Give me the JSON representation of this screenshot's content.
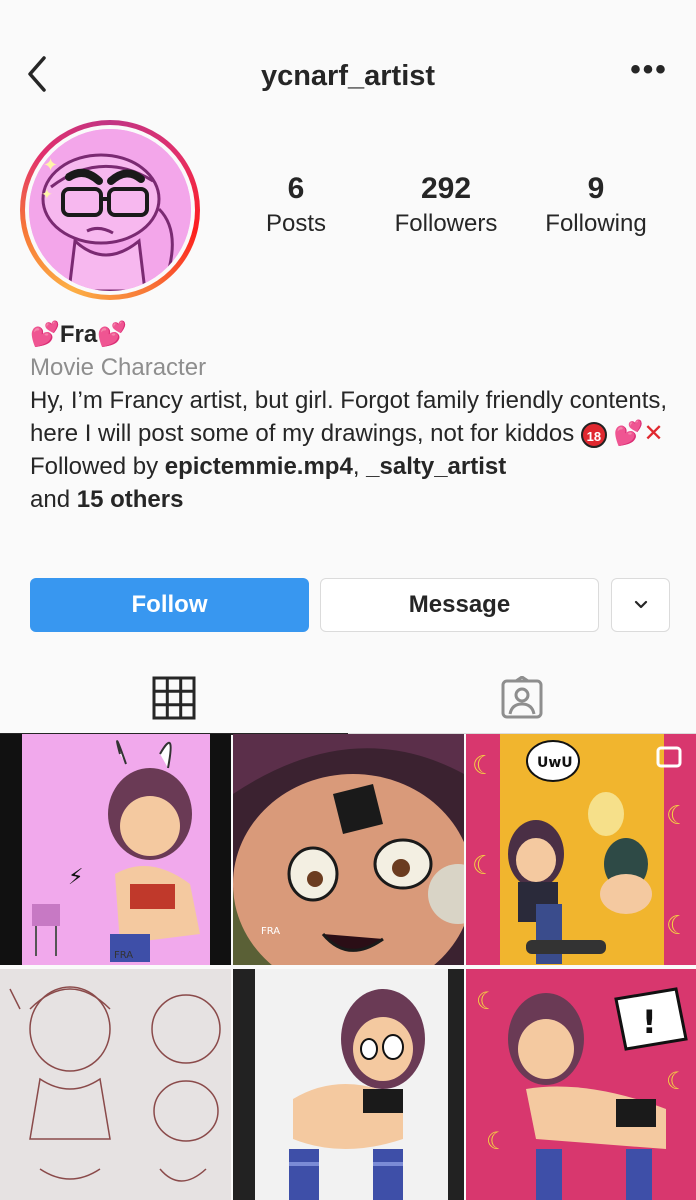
{
  "header": {
    "username": "ycnarf_artist",
    "back_icon": "chevron-left-icon",
    "more_icon": "more-horizontal-icon",
    "more_glyph": "•••"
  },
  "stats": {
    "posts": {
      "value": "6",
      "label": "Posts"
    },
    "followers": {
      "value": "292",
      "label": "Followers"
    },
    "following": {
      "value": "9",
      "label": "Following"
    }
  },
  "bio": {
    "name": "Fra",
    "name_emoji": "💕",
    "category": "Movie Character",
    "text": "Hy, I’m Francy artist, but girl. Forgot family friendly contents, here I will post some of my drawings, not for kiddos",
    "badge_18": "18",
    "heart_emoji": "💕",
    "x_emoji": "✕",
    "followed_by_prefix": "Followed by ",
    "follower_1": "epictemmie.mp4",
    "separator": ", ",
    "follower_2": "_salty_artist",
    "and_text": "and ",
    "others": "15 others"
  },
  "actions": {
    "follow_label": "Follow",
    "message_label": "Message",
    "dropdown_icon": "chevron-down-icon"
  },
  "tabs": [
    {
      "name": "grid-tab",
      "icon": "grid-icon",
      "active": true
    },
    {
      "name": "tagged-tab",
      "icon": "tagged-person-icon",
      "active": false
    }
  ],
  "posts_grid": [
    {
      "label": "FRA"
    },
    {
      "label": "FRA"
    },
    {
      "label": "UwU"
    },
    {
      "label": ""
    },
    {
      "label": ""
    },
    {
      "label": "!"
    }
  ],
  "colors": {
    "follow_blue": "#3897f0",
    "avatar_pink": "#f3a6ea",
    "text_dark": "#262626",
    "text_gray": "#8e8e8e"
  }
}
